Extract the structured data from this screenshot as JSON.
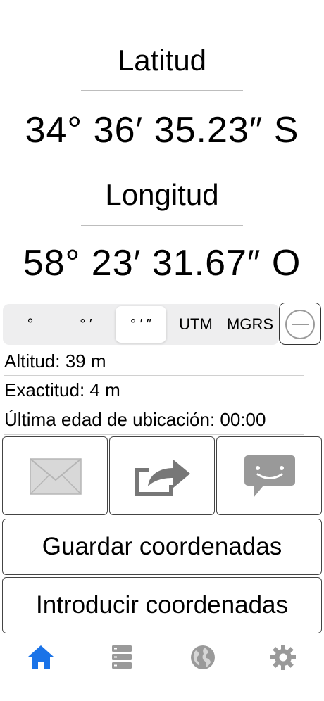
{
  "latitude": {
    "label": "Latitud",
    "value": "34° 36′ 35.23″ S"
  },
  "longitude": {
    "label": "Longitud",
    "value": "58° 23′ 31.67″ O"
  },
  "format_selector": {
    "options": [
      "°",
      "° ′",
      "° ′ ″",
      "UTM",
      "MGRS"
    ],
    "selected": "° ′ ″"
  },
  "info": {
    "altitude": "Altitud: 39 m",
    "accuracy": "Exactitud: 4 m",
    "location_age": "Última edad de ubicación: 00:00"
  },
  "actions": {
    "icons": [
      "mail-icon",
      "share-icon",
      "message-icon"
    ]
  },
  "buttons": {
    "save": "Guardar coordenadas",
    "enter": "Introducir coordenadas"
  },
  "tab_bar": {
    "tabs": [
      "home-icon",
      "list-icon",
      "globe-icon",
      "gear-icon"
    ],
    "active": "home-icon",
    "active_color": "#1a73e8",
    "inactive_color": "#9a9a9a"
  }
}
